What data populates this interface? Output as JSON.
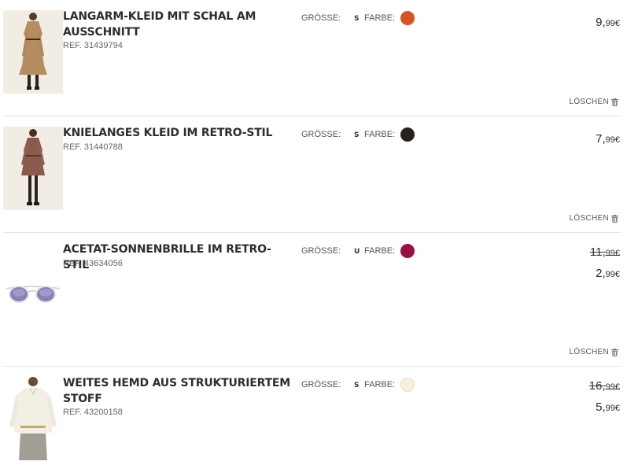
{
  "labels": {
    "size": "GRÖSSE:",
    "color": "FARBE:",
    "delete": "LÖSCHEN"
  },
  "items": [
    {
      "title": "LANGARM-KLEID MIT SCHAL AM AUSSCHNITT",
      "ref": "REF. 31439794",
      "size": "S",
      "color_hex": "#d8531d",
      "old_price": null,
      "price_main": "9,",
      "price_cents": "99€"
    },
    {
      "title": "KNIELANGES KLEID IM RETRO-STIL",
      "ref": "REF. 31440788",
      "size": "S",
      "color_hex": "#2b211c",
      "old_price": null,
      "price_main": "7,",
      "price_cents": "99€"
    },
    {
      "title": "ACETAT-SONNENBRILLE IM RETRO-STIL",
      "ref": "REF. 43634056",
      "size": "U",
      "color_hex": "#9a1045",
      "old_main": "11,",
      "old_cents": "99€",
      "price_main": "2,",
      "price_cents": "99€"
    },
    {
      "title": "WEITES HEMD AUS STRUKTURIERTEM STOFF",
      "ref": "REF. 43200158",
      "size": "S",
      "color_hex": "#f6f0dc",
      "old_main": "16,",
      "old_cents": "99€",
      "price_main": "5,",
      "price_cents": "99€"
    }
  ]
}
